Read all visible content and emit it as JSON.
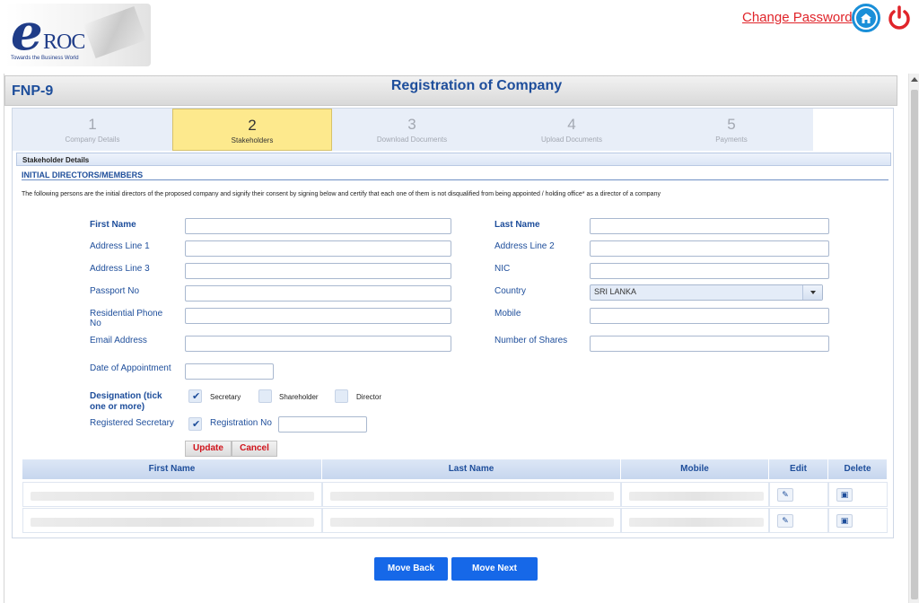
{
  "header": {
    "logo_mark": "e",
    "logo_name": "ROC",
    "logo_tagline": "Towards the Business World",
    "change_password": "Change Password"
  },
  "form": {
    "code": "FNP-9",
    "title": "Registration of Company"
  },
  "steps": [
    {
      "num": "1",
      "label": "Company Details"
    },
    {
      "num": "2",
      "label": "Stakeholders"
    },
    {
      "num": "3",
      "label": "Download Documents"
    },
    {
      "num": "4",
      "label": "Upload Documents"
    },
    {
      "num": "5",
      "label": "Payments"
    }
  ],
  "section": {
    "bar": "Stakeholder Details",
    "title": "INITIAL DIRECTORS/MEMBERS",
    "description": "The following persons are the initial directors of the proposed company and signify their consent by signing below and certify that each one of them is not disqualified from being appointed / holding office* as a director of a company"
  },
  "fields": {
    "first_name": "First Name",
    "last_name": "Last Name",
    "address1": "Address Line 1",
    "address2": "Address Line 2",
    "address3": "Address Line 3",
    "nic": "NIC",
    "passport": "Passport No",
    "country": "Country",
    "country_value": "SRI LANKA",
    "res_phone": "Residential Phone No",
    "mobile": "Mobile",
    "email": "Email Address",
    "shares": "Number of Shares",
    "appointment": "Date of Appointment",
    "designation": "Designation (tick one or more)",
    "secretary": "Secretary",
    "shareholder": "Shareholder",
    "director": "Director",
    "reg_secretary": "Registered Secretary",
    "reg_no": "Registration No"
  },
  "actions": {
    "update": "Update",
    "cancel": "Cancel",
    "move_back": "Move Back",
    "move_next": "Move Next"
  },
  "grid": {
    "headers": [
      "First Name",
      "Last Name",
      "Mobile",
      "Edit",
      "Delete"
    ]
  },
  "colors": {
    "brand_blue": "#1e4e9b",
    "accent_red": "#e0242a",
    "active_step": "#fde98d",
    "button_blue": "#1668e8"
  }
}
